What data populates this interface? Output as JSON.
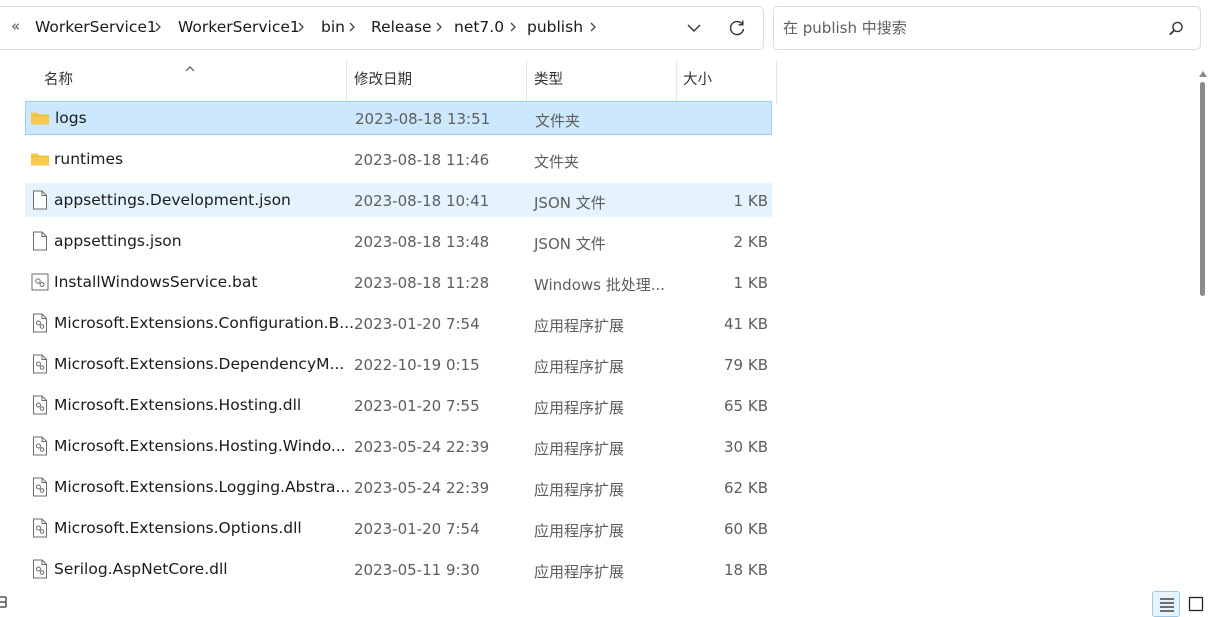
{
  "address": {
    "overflow_glyph": "«",
    "crumbs": [
      "WorkerService1",
      "WorkerService1",
      "bin",
      "Release",
      "net7.0",
      "publish"
    ]
  },
  "search": {
    "placeholder": "在 publish 中搜索",
    "value": ""
  },
  "columns": {
    "name": "名称",
    "date": "修改日期",
    "type": "类型",
    "size": "大小"
  },
  "files": [
    {
      "name": "logs",
      "date": "2023-08-18 13:51",
      "type": "文件夹",
      "size": "",
      "icon": "folder-icon",
      "state": "selected"
    },
    {
      "name": "runtimes",
      "date": "2023-08-18 11:46",
      "type": "文件夹",
      "size": "",
      "icon": "folder-icon",
      "state": ""
    },
    {
      "name": "appsettings.Development.json",
      "date": "2023-08-18 10:41",
      "type": "JSON 文件",
      "size": "1 KB",
      "icon": "file-icon",
      "state": "hover"
    },
    {
      "name": "appsettings.json",
      "date": "2023-08-18 13:48",
      "type": "JSON 文件",
      "size": "2 KB",
      "icon": "file-icon",
      "state": ""
    },
    {
      "name": "InstallWindowsService.bat",
      "date": "2023-08-18 11:28",
      "type": "Windows 批处理...",
      "size": "1 KB",
      "icon": "batch-file-icon",
      "state": ""
    },
    {
      "name": "Microsoft.Extensions.Configuration.B...",
      "date": "2023-01-20 7:54",
      "type": "应用程序扩展",
      "size": "41 KB",
      "icon": "dll-file-icon",
      "state": ""
    },
    {
      "name": "Microsoft.Extensions.DependencyM...",
      "date": "2022-10-19 0:15",
      "type": "应用程序扩展",
      "size": "79 KB",
      "icon": "dll-file-icon",
      "state": ""
    },
    {
      "name": "Microsoft.Extensions.Hosting.dll",
      "date": "2023-01-20 7:55",
      "type": "应用程序扩展",
      "size": "65 KB",
      "icon": "dll-file-icon",
      "state": ""
    },
    {
      "name": "Microsoft.Extensions.Hosting.Windo...",
      "date": "2023-05-24 22:39",
      "type": "应用程序扩展",
      "size": "30 KB",
      "icon": "dll-file-icon",
      "state": ""
    },
    {
      "name": "Microsoft.Extensions.Logging.Abstra...",
      "date": "2023-05-24 22:39",
      "type": "应用程序扩展",
      "size": "62 KB",
      "icon": "dll-file-icon",
      "state": ""
    },
    {
      "name": "Microsoft.Extensions.Options.dll",
      "date": "2023-01-20 7:54",
      "type": "应用程序扩展",
      "size": "60 KB",
      "icon": "dll-file-icon",
      "state": ""
    },
    {
      "name": "Serilog.AspNetCore.dll",
      "date": "2023-05-11 9:30",
      "type": "应用程序扩展",
      "size": "18 KB",
      "icon": "dll-file-icon",
      "state": ""
    }
  ],
  "colors": {
    "selected_bg": "#cce8ff",
    "selected_border": "#99d1ff",
    "hover_bg": "#e5f3ff",
    "folder": "#f8c94c"
  }
}
